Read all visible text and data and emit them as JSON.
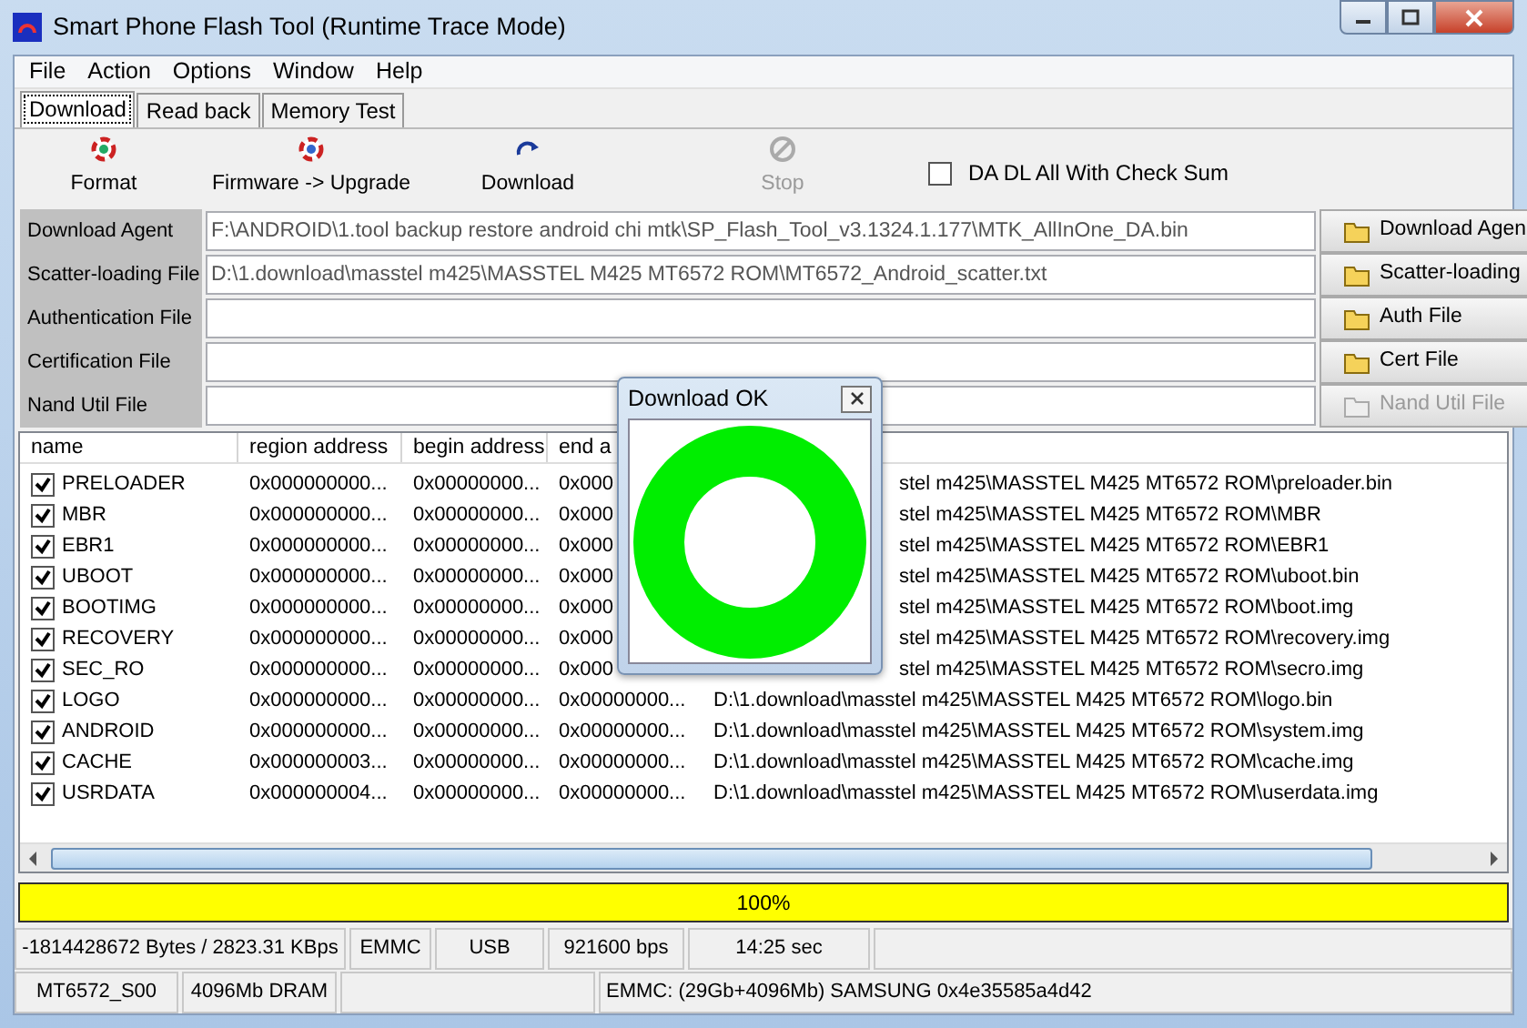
{
  "window": {
    "title": "Smart Phone Flash Tool (Runtime Trace Mode)"
  },
  "menu": [
    "File",
    "Action",
    "Options",
    "Window",
    "Help"
  ],
  "tabs": [
    {
      "label": "Download",
      "selected": true
    },
    {
      "label": "Read back",
      "selected": false
    },
    {
      "label": "Memory Test",
      "selected": false
    }
  ],
  "toolbar": [
    {
      "kind": "format",
      "label": "Format",
      "disabled": false
    },
    {
      "kind": "upgrade",
      "label": "Firmware -> Upgrade",
      "disabled": false
    },
    {
      "kind": "download",
      "label": "Download",
      "disabled": false
    },
    {
      "kind": "stop",
      "label": "Stop",
      "disabled": true
    }
  ],
  "checksum_option": {
    "label": "DA DL All With Check Sum",
    "checked": false
  },
  "file_rows": [
    {
      "label": "Download Agent",
      "value": "F:\\ANDROID\\1.tool backup restore android chi mtk\\SP_Flash_Tool_v3.1324.1.177\\MTK_AllInOne_DA.bin",
      "button": "Download Agen",
      "disabled": false
    },
    {
      "label": "Scatter-loading File",
      "value": "D:\\1.download\\masstel m425\\MASSTEL M425 MT6572 ROM\\MT6572_Android_scatter.txt",
      "button": "Scatter-loading",
      "disabled": false
    },
    {
      "label": "Authentication File",
      "button": "Auth File",
      "disabled": false
    },
    {
      "label": "Certification File",
      "button": "Cert File",
      "disabled": false
    },
    {
      "label": "Nand Util File",
      "button": "Nand Util File",
      "disabled": true
    }
  ],
  "table": {
    "columns": [
      "name",
      "region address",
      "begin address",
      "end a"
    ],
    "rows": [
      {
        "checked": true,
        "name": "PRELOADER",
        "region": "0x000000000...",
        "begin": "0x00000000...",
        "end": "0x000",
        "path": "stel m425\\MASSTEL M425 MT6572 ROM\\preloader.bin",
        "covered": true
      },
      {
        "checked": true,
        "name": "MBR",
        "region": "0x000000000...",
        "begin": "0x00000000...",
        "end": "0x000",
        "path": "stel m425\\MASSTEL M425 MT6572 ROM\\MBR",
        "covered": true
      },
      {
        "checked": true,
        "name": "EBR1",
        "region": "0x000000000...",
        "begin": "0x00000000...",
        "end": "0x000",
        "path": "stel m425\\MASSTEL M425 MT6572 ROM\\EBR1",
        "covered": true
      },
      {
        "checked": true,
        "name": "UBOOT",
        "region": "0x000000000...",
        "begin": "0x00000000...",
        "end": "0x000",
        "path": "stel m425\\MASSTEL M425 MT6572 ROM\\uboot.bin",
        "covered": true
      },
      {
        "checked": true,
        "name": "BOOTIMG",
        "region": "0x000000000...",
        "begin": "0x00000000...",
        "end": "0x000",
        "path": "stel m425\\MASSTEL M425 MT6572 ROM\\boot.img",
        "covered": true
      },
      {
        "checked": true,
        "name": "RECOVERY",
        "region": "0x000000000...",
        "begin": "0x00000000...",
        "end": "0x000",
        "path": "stel m425\\MASSTEL M425 MT6572 ROM\\recovery.img",
        "covered": true
      },
      {
        "checked": true,
        "name": "SEC_RO",
        "region": "0x000000000...",
        "begin": "0x00000000...",
        "end": "0x000",
        "path": "stel m425\\MASSTEL M425 MT6572 ROM\\secro.img",
        "covered": true
      },
      {
        "checked": true,
        "name": "LOGO",
        "region": "0x000000000...",
        "begin": "0x00000000...",
        "end": "0x00000000...",
        "path": "D:\\1.download\\masstel m425\\MASSTEL M425 MT6572 ROM\\logo.bin",
        "covered": false
      },
      {
        "checked": true,
        "name": "ANDROID",
        "region": "0x000000000...",
        "begin": "0x00000000...",
        "end": "0x00000000...",
        "path": "D:\\1.download\\masstel m425\\MASSTEL M425 MT6572 ROM\\system.img",
        "covered": false
      },
      {
        "checked": true,
        "name": "CACHE",
        "region": "0x000000003...",
        "begin": "0x00000000...",
        "end": "0x00000000...",
        "path": "D:\\1.download\\masstel m425\\MASSTEL M425 MT6572 ROM\\cache.img",
        "covered": false
      },
      {
        "checked": true,
        "name": "USRDATA",
        "region": "0x000000004...",
        "begin": "0x00000000...",
        "end": "0x00000000...",
        "path": "D:\\1.download\\masstel m425\\MASSTEL M425 MT6572 ROM\\userdata.img",
        "covered": false
      }
    ]
  },
  "dialog": {
    "title": "Download OK"
  },
  "progress": {
    "level": 1,
    "label": "100%"
  },
  "status_bar": [
    [
      {
        "kind": "text",
        "text": "-1814428672 Bytes / 2823.31 KBps"
      },
      {
        "kind": "text",
        "text": "EMMC"
      },
      {
        "kind": "text",
        "text": "USB"
      },
      {
        "kind": "text",
        "text": "921600 bps"
      },
      {
        "kind": "text",
        "text": "14:25 sec"
      },
      {
        "kind": "blank"
      }
    ],
    [
      {
        "kind": "text",
        "text": "MT6572_S00"
      },
      {
        "kind": "text",
        "text": "4096Mb DRAM"
      },
      {
        "kind": "blank"
      },
      {
        "kind": "text",
        "text": "EMMC: (29Gb+4096Mb) SAMSUNG 0x4e35585a4d42"
      }
    ]
  ]
}
